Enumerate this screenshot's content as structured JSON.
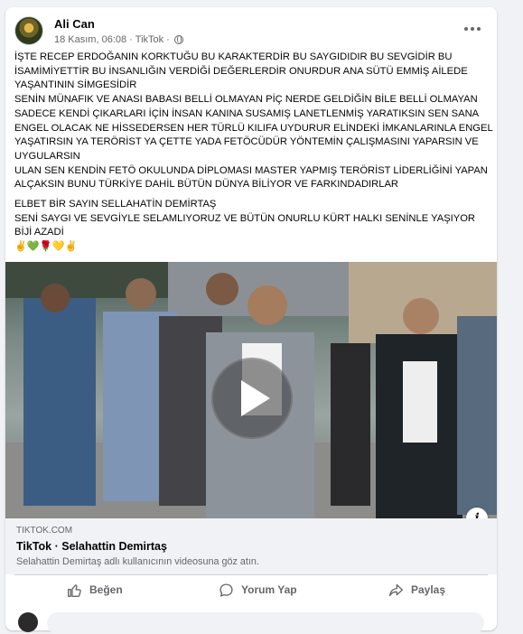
{
  "post": {
    "author": "Ali Can",
    "date": "18 Kasım, 06:08",
    "separator": "·",
    "source": "TikTok",
    "separator2": "·",
    "privacy_icon": "globe-icon",
    "more_icon": "more-options-icon"
  },
  "text": {
    "lines": [
      "İŞTE RECEP ERDOĞANIN KORKTUĞU BU KARAKTERDİR BU SAYGIDIDIR BU SEVGİDİR BU",
      "İSAMİMİYETTİR BU İNSANLIĞIN VERDİĞİ DEĞERLERDİR ONURDUR ANA SÜTÜ EMMİŞ AİLEDE",
      "YAŞANTININ SİMGESİDİR",
      "SENİN MÜNAFIK VE ANASI BABASI BELLİ OLMAYAN PİÇ NERDE GELDİĞİN BİLE BELLİ OLMAYAN",
      "SADECE KENDİ ÇIKARLARI İÇİN İNSAN KANINA SUSAMIŞ LANETLENMİŞ YARATIKSIN SEN SANA",
      "ENGEL OLACAK NE HİSSEDERSEN HER TÜRLÜ KILIFA UYDURUR ELİNDEKİ İMKANLARINLA ENGEL",
      "YAŞATIRSIN YA TERÖRİST YA ÇETTE YADA FETÖCÜDÜR YÖNTEMİN ÇALIŞMASINI YAPARSIN VE",
      "UYGULARSIN",
      "ULAN SEN KENDİN FETÖ OKULUNDA DİPLOMASI MASTER YAPMIŞ TERÖRİST LİDERLİĞİNİ YAPAN",
      "ALÇAKSIN BUNU TÜRKİYE DAHİL BÜTÜN DÜNYA BİLİYOR VE FARKINDADIRLAR"
    ],
    "lines2": [
      "ELBET BİR SAYIN SELLAHATİN DEMİRTAŞ",
      "SENİ SAYGI VE SEVGİYLE SELAMLIYORUZ VE BÜTÜN ONURLU KÜRT HALKI SENİNLE YAŞIYOR",
      "BİJİ AZADİ",
      "✌️💚🌹💛✌️"
    ]
  },
  "video": {
    "play_icon": "play-icon",
    "info_icon_label": "i"
  },
  "link": {
    "domain": "TIKTOK.COM",
    "title": "TikTok · Selahattin Demirtaş",
    "description": "Selahattin Demirtaş adlı kullanıcının videosuna göz atın."
  },
  "actions": {
    "like": "Beğen",
    "comment": "Yorum Yap",
    "share": "Paylaş"
  }
}
